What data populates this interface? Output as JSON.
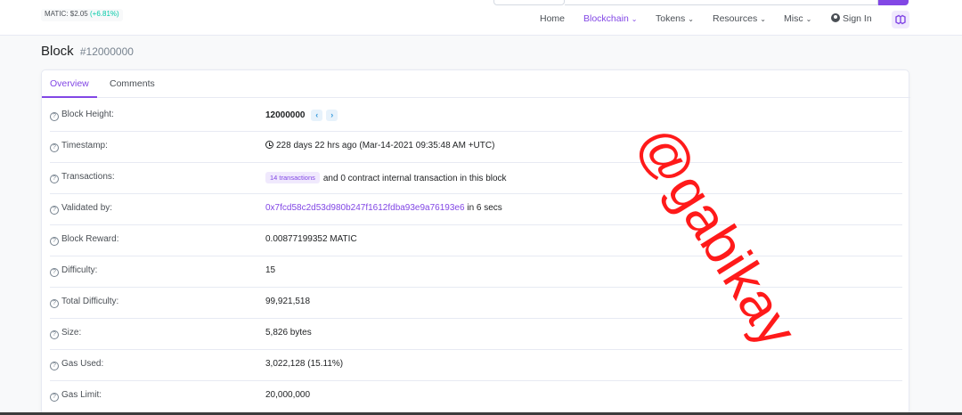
{
  "header": {
    "price_label": "MATIC: $2.05",
    "price_change": "(+6.81%)",
    "nav": {
      "home": "Home",
      "blockchain": "Blockchain",
      "tokens": "Tokens",
      "resources": "Resources",
      "misc": "Misc",
      "sign_in": "Sign In"
    },
    "chevron": "⌄"
  },
  "page": {
    "title": "Block",
    "block_ref": "#12000000"
  },
  "tabs": {
    "overview": "Overview",
    "comments": "Comments"
  },
  "rows": [
    {
      "label": "Block Height:",
      "value": "12000000"
    },
    {
      "label": "Timestamp:",
      "value": "228 days 22 hrs ago (Mar-14-2021 09:35:48 AM +UTC)"
    },
    {
      "label": "Transactions:",
      "badge": "14 transactions",
      "value": "and 0 contract internal transaction in this block"
    },
    {
      "label": "Validated by:",
      "link": "0x7fcd58c2d53d980b247f1612fdba93e9a76193e6",
      "value": "in 6 secs"
    },
    {
      "label": "Block Reward:",
      "value": "0.00877199352 MATIC"
    },
    {
      "label": "Difficulty:",
      "value": "15"
    },
    {
      "label": "Total Difficulty:",
      "value": "99,921,518"
    },
    {
      "label": "Size:",
      "value": "5,826 bytes"
    },
    {
      "label": "Gas Used:",
      "value": "3,022,128 (15.11%)"
    },
    {
      "label": "Gas Limit:",
      "value": "20,000,000"
    }
  ],
  "watermark": "@gabikay",
  "colors": {
    "accent": "#8247e5",
    "positive": "#00c9a7",
    "watermark": "#ff1a1a"
  }
}
